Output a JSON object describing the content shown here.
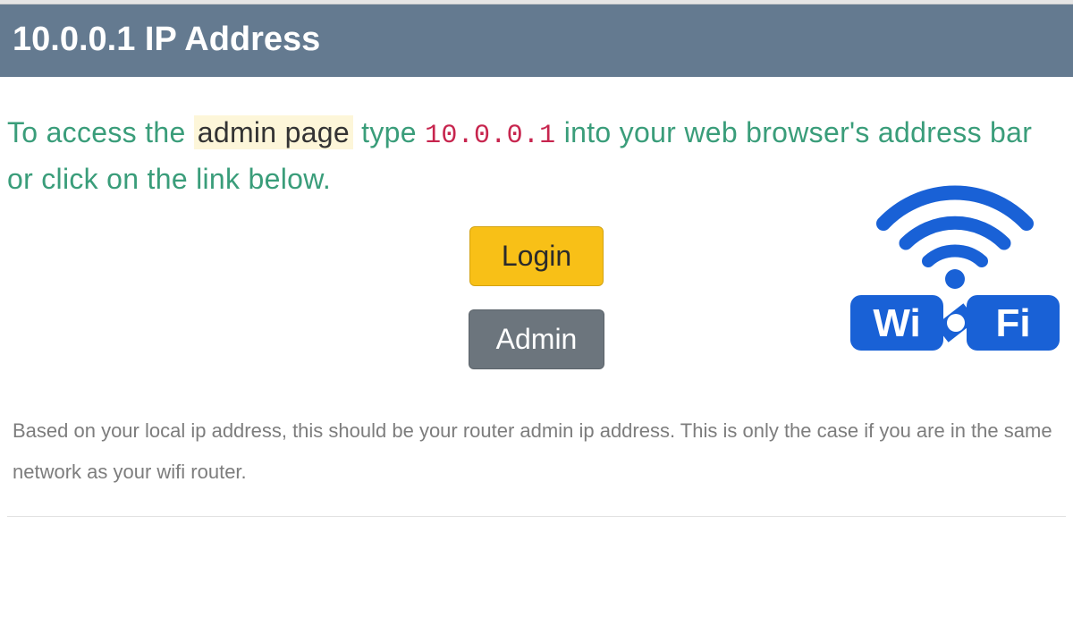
{
  "header": {
    "title": "10.0.0.1 IP Address"
  },
  "instruction": {
    "pre": "To access the ",
    "highlight": "admin page",
    "mid": " type ",
    "ip": "10.0.0.1",
    "post": " into your web browser's address bar or click on the link below."
  },
  "buttons": {
    "login": "Login",
    "admin": "Admin"
  },
  "wifi": {
    "text_left": "Wi",
    "text_right": "Fi"
  },
  "footer": {
    "text": "Based on your local ip address, this should be your router admin ip address. This is only the case if you are in the same network as your wifi router."
  },
  "colors": {
    "brand_blue": "#1961d6"
  }
}
